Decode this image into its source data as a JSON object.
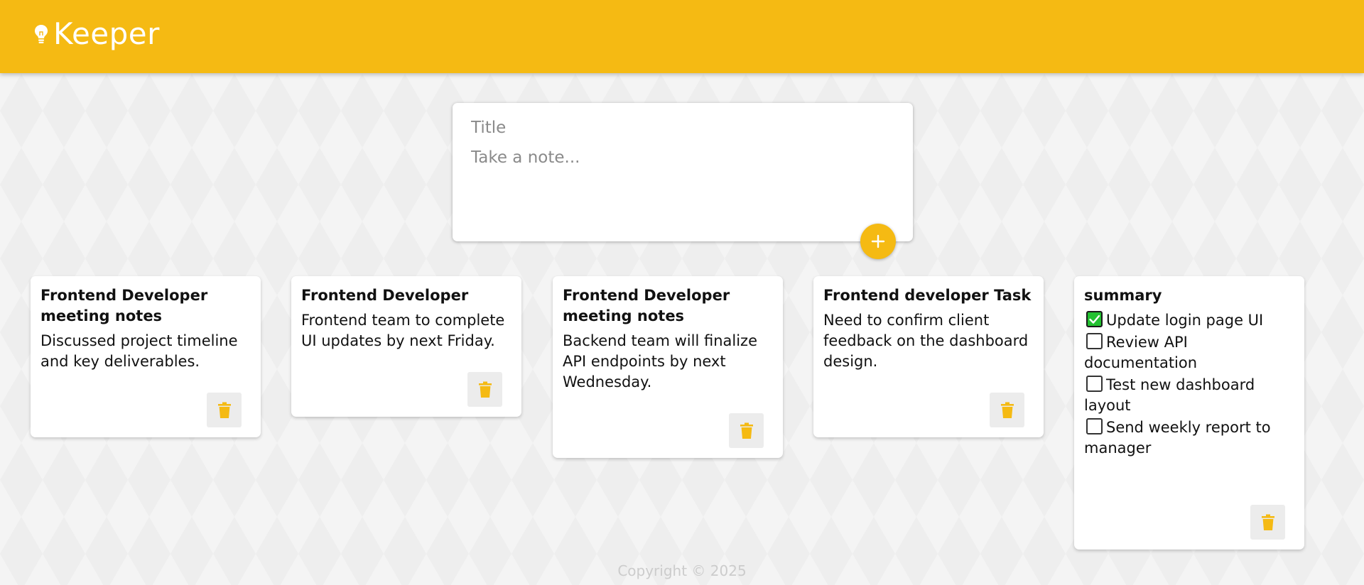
{
  "app": {
    "title": "Keeper"
  },
  "colors": {
    "accent": "#f5ba13",
    "checked": "#23c131"
  },
  "composer": {
    "title_placeholder": "Title",
    "content_placeholder": "Take a note..."
  },
  "notes": [
    {
      "title": "Frontend Developer meeting notes",
      "content": "Discussed project timeline and key deliverables."
    },
    {
      "title": "Frontend Developer",
      "content": "Frontend team to complete UI updates by next Friday."
    },
    {
      "title": "Frontend Developer meeting notes",
      "content": "Backend team will finalize API endpoints by next Wednesday."
    },
    {
      "title": "Frontend developer Task",
      "content": "Need to confirm client feedback on the dashboard design."
    },
    {
      "title": "summary",
      "checklist": [
        {
          "label": "Update login page UI",
          "checked": true
        },
        {
          "label": "Review API documentation",
          "checked": false
        },
        {
          "label": "Test new dashboard layout",
          "checked": false
        },
        {
          "label": "Send weekly report to manager",
          "checked": false
        }
      ]
    }
  ],
  "icons": {
    "logo": "lightbulb-icon",
    "add": "plus-icon",
    "delete": "trash-icon",
    "check": "checkmark-icon"
  },
  "footer": {
    "copyright": "Copyright © 2025"
  }
}
